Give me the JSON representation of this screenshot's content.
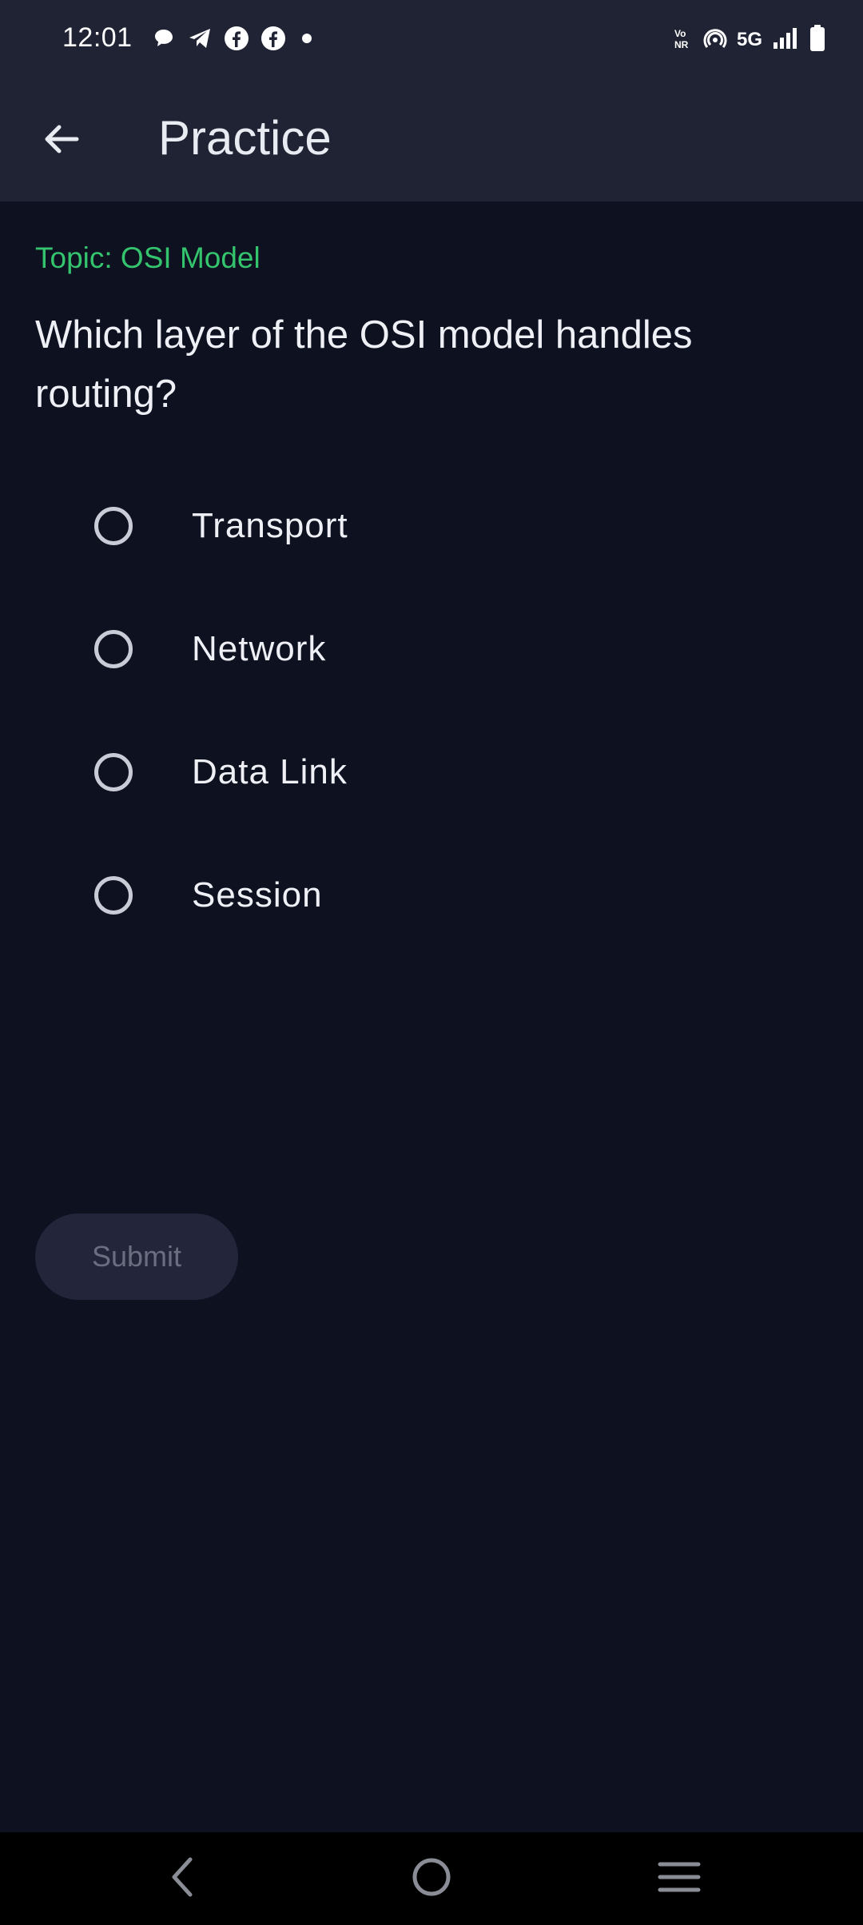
{
  "status_bar": {
    "time": "12:01",
    "left_icons": [
      "chat-bubble-icon",
      "telegram-icon",
      "facebook-icon",
      "facebook-icon",
      "dot-icon"
    ],
    "network_label": "5G",
    "right_icons": [
      "vonr-icon",
      "hotspot-icon",
      "signal-icon",
      "battery-icon"
    ]
  },
  "app_bar": {
    "back_icon": "arrow-left-icon",
    "title": "Practice"
  },
  "quiz": {
    "topic": "Topic: OSI Model",
    "question": "Which layer of the OSI model handles routing?",
    "options": [
      {
        "label": "Transport",
        "selected": false
      },
      {
        "label": "Network",
        "selected": false
      },
      {
        "label": "Data Link",
        "selected": false
      },
      {
        "label": "Session",
        "selected": false
      }
    ],
    "submit_label": "Submit",
    "submit_enabled": false
  },
  "colors": {
    "background": "#0d1120",
    "app_bar": "#1f2333",
    "topic_accent": "#34c46e",
    "submit_disabled_bg": "#23263a"
  },
  "nav_bar": {
    "icons": [
      "back-chevron-icon",
      "home-circle-icon",
      "recents-menu-icon"
    ]
  }
}
